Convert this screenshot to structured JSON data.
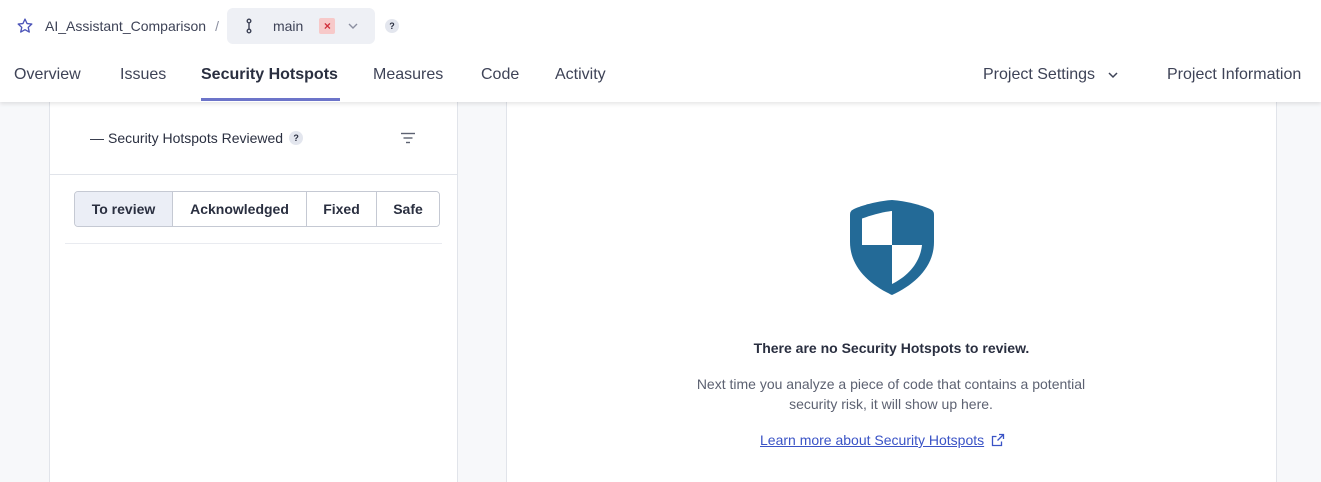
{
  "breadcrumb": {
    "project_name": "AI_Assistant_Comparison",
    "separator": "/",
    "branch_name": "main",
    "branch_status_glyph": "×",
    "help_glyph": "?"
  },
  "nav": {
    "tabs": [
      {
        "label": "Overview"
      },
      {
        "label": "Issues"
      },
      {
        "label": "Security Hotspots",
        "active": true
      },
      {
        "label": "Measures"
      },
      {
        "label": "Code"
      },
      {
        "label": "Activity"
      }
    ],
    "project_settings": "Project Settings",
    "project_information": "Project Information"
  },
  "sidebar": {
    "reviewed_value": "—",
    "reviewed_label": "Security Hotspots Reviewed",
    "help_glyph": "?",
    "status_filters": [
      {
        "label": "To review",
        "selected": true
      },
      {
        "label": "Acknowledged"
      },
      {
        "label": "Fixed"
      },
      {
        "label": "Safe"
      }
    ]
  },
  "empty_state": {
    "title": "There are no Security Hotspots to review.",
    "description": "Next time you analyze a piece of code that contains a potential security risk, it will show up here.",
    "link": "Learn more about Security Hotspots"
  },
  "icons": {
    "star": "star-icon",
    "branch": "branch-icon",
    "filter": "filter-icon",
    "shield": "shield-icon",
    "external_link": "external-link-icon"
  },
  "colors": {
    "accent": "#6c74c9",
    "shield": "#236a97",
    "link": "#3a53c6",
    "fail_badge_bg": "#f7c9c9",
    "fail_badge_fg": "#d02f3a"
  }
}
